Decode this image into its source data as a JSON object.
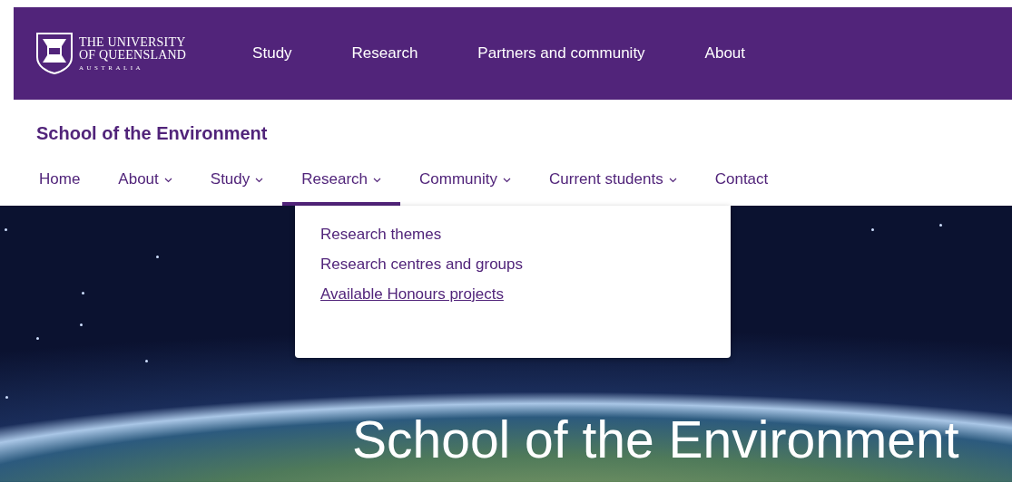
{
  "header": {
    "logo": {
      "line_1": "THE UNIVERSITY",
      "line_2": "OF QUEENSLAND",
      "line_3": "AUSTRALIA"
    },
    "nav": [
      {
        "label": "Study"
      },
      {
        "label": "Research"
      },
      {
        "label": "Partners and community"
      },
      {
        "label": "About"
      }
    ]
  },
  "site_title": "School of the Environment",
  "subnav": [
    {
      "label": "Home",
      "has_dropdown": false,
      "selected": false
    },
    {
      "label": "About",
      "has_dropdown": true,
      "selected": false
    },
    {
      "label": "Study",
      "has_dropdown": true,
      "selected": false
    },
    {
      "label": "Research",
      "has_dropdown": true,
      "selected": true
    },
    {
      "label": "Community",
      "has_dropdown": true,
      "selected": false
    },
    {
      "label": "Current students",
      "has_dropdown": true,
      "selected": false
    },
    {
      "label": "Contact",
      "has_dropdown": false,
      "selected": false
    }
  ],
  "dropdown": {
    "items": [
      {
        "label": "Research themes",
        "hovered": false
      },
      {
        "label": "Research centres and groups",
        "hovered": false
      },
      {
        "label": "Available Honours projects",
        "hovered": true
      }
    ]
  },
  "hero": {
    "title": "School of the Environment"
  }
}
